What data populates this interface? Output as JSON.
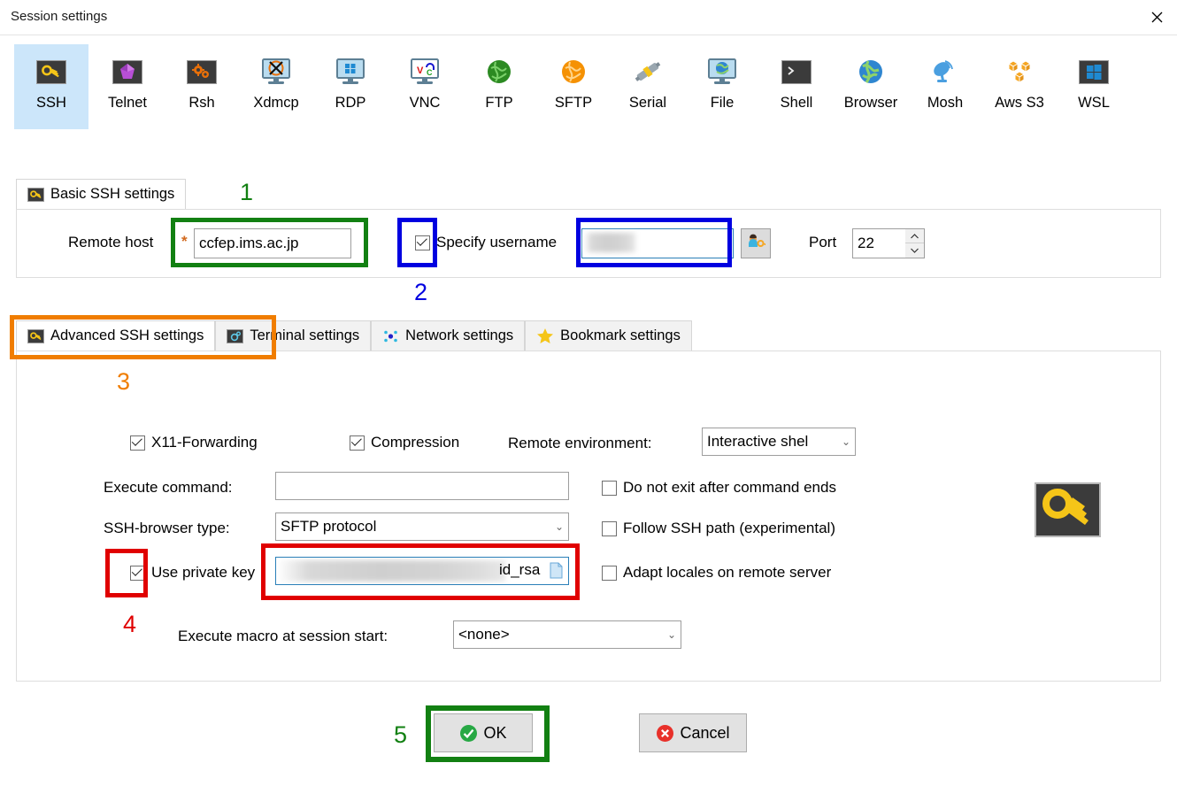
{
  "window": {
    "title": "Session settings",
    "close_icon": "close-icon"
  },
  "protocols": [
    {
      "label": "SSH",
      "icon": "ssh-key-icon",
      "selected": true
    },
    {
      "label": "Telnet",
      "icon": "telnet-crystal-icon",
      "selected": false
    },
    {
      "label": "Rsh",
      "icon": "rsh-gears-icon",
      "selected": false
    },
    {
      "label": "Xdmcp",
      "icon": "xdmcp-monitor-icon",
      "selected": false
    },
    {
      "label": "RDP",
      "icon": "rdp-windows-icon",
      "selected": false
    },
    {
      "label": "VNC",
      "icon": "vnc-monitor-icon",
      "selected": false
    },
    {
      "label": "FTP",
      "icon": "ftp-globe-icon",
      "selected": false
    },
    {
      "label": "SFTP",
      "icon": "sftp-globe-icon",
      "selected": false
    },
    {
      "label": "Serial",
      "icon": "serial-plug-icon",
      "selected": false
    },
    {
      "label": "File",
      "icon": "file-monitor-icon",
      "selected": false
    },
    {
      "label": "Shell",
      "icon": "shell-console-icon",
      "selected": false
    },
    {
      "label": "Browser",
      "icon": "browser-globe-icon",
      "selected": false
    },
    {
      "label": "Mosh",
      "icon": "mosh-dish-icon",
      "selected": false
    },
    {
      "label": "Aws S3",
      "icon": "aws-s3-cubes-icon",
      "selected": false
    },
    {
      "label": "WSL",
      "icon": "wsl-windows-icon",
      "selected": false
    }
  ],
  "basic_panel": {
    "tab_label": "Basic SSH settings",
    "tab_icon": "ssh-key-icon",
    "remote_host_label": "Remote host",
    "required_marker": "*",
    "remote_host_value": "ccfep.ims.ac.jp",
    "specify_username_label": "Specify username",
    "specify_username_checked": true,
    "username_value": "",
    "username_redacted": true,
    "user_picker_icon": "user-key-icon",
    "port_label": "Port",
    "port_value": "22",
    "spinner_up_icon": "chevron-up-icon",
    "spinner_down_icon": "chevron-down-icon"
  },
  "settings_tabs": [
    {
      "label": "Advanced SSH settings",
      "icon": "ssh-key-icon",
      "active": true
    },
    {
      "label": "Terminal settings",
      "icon": "terminal-icon",
      "active": false
    },
    {
      "label": "Network settings",
      "icon": "network-icon",
      "active": false
    },
    {
      "label": "Bookmark settings",
      "icon": "star-icon",
      "active": false
    }
  ],
  "advanced_panel": {
    "x11_label": "X11-Forwarding",
    "x11_checked": true,
    "compression_label": "Compression",
    "compression_checked": true,
    "remote_env_label": "Remote environment:",
    "remote_env_value": "Interactive shel",
    "execute_command_label": "Execute command:",
    "execute_command_value": "",
    "do_not_exit_label": "Do not exit after command ends",
    "do_not_exit_checked": false,
    "ssh_browser_label": "SSH-browser type:",
    "ssh_browser_value": "SFTP protocol",
    "follow_ssh_path_label": "Follow SSH path (experimental)",
    "follow_ssh_path_checked": false,
    "use_private_key_label": "Use private key",
    "use_private_key_checked": true,
    "private_key_value": "id_rsa",
    "private_key_redacted": true,
    "private_key_browse_icon": "file-browse-icon",
    "adapt_locales_label": "Adapt locales on remote server",
    "adapt_locales_checked": false,
    "execute_macro_label": "Execute macro at session start:",
    "execute_macro_value": "<none>",
    "side_icon": "ssh-key-icon"
  },
  "footer": {
    "ok_label": "OK",
    "ok_icon": "check-circle-icon",
    "cancel_label": "Cancel",
    "cancel_icon": "x-circle-icon"
  },
  "annotations": {
    "colors": {
      "green": "#128012",
      "blue": "#0000e0",
      "orange": "#f07d00",
      "red": "#e00000"
    },
    "steps": [
      {
        "number": "1",
        "color": "#128012"
      },
      {
        "number": "2",
        "color": "#0000e0"
      },
      {
        "number": "3",
        "color": "#f07d00"
      },
      {
        "number": "4",
        "color": "#e00000"
      },
      {
        "number": "5",
        "color": "#128012"
      }
    ]
  }
}
